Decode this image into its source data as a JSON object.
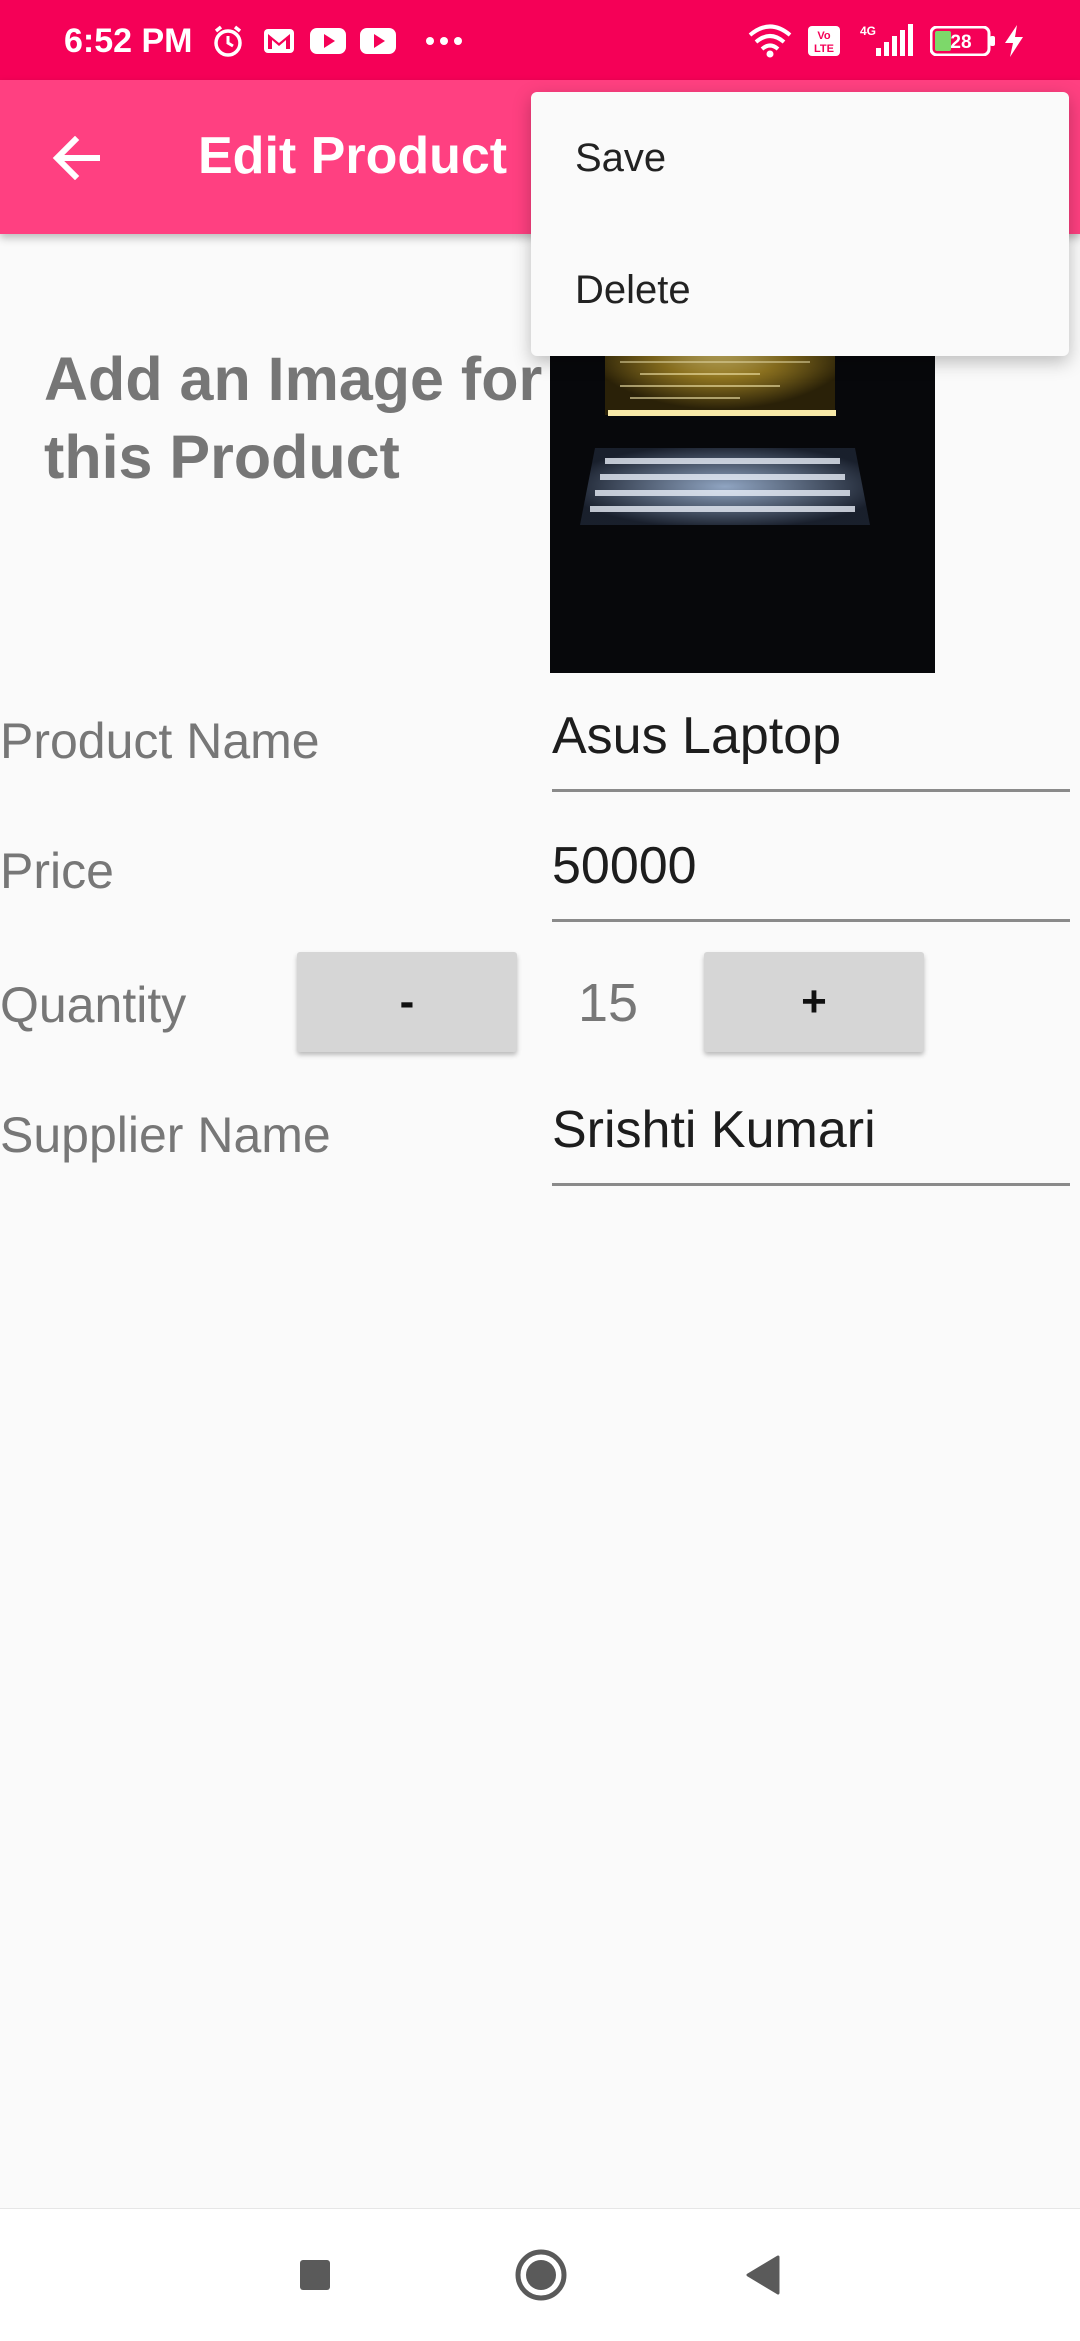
{
  "status_bar": {
    "time": "6:52 PM",
    "battery": "28",
    "icons": [
      "alarm-icon",
      "gmail-icon",
      "youtube-icon",
      "youtube-icon",
      "more-dots-icon",
      "wifi-icon",
      "volte-icon",
      "signal-4g-icon",
      "battery-icon",
      "charging-icon"
    ]
  },
  "app_bar": {
    "title": "Edit Product",
    "back_icon": "arrow-back-icon",
    "background": "#ff4081"
  },
  "overflow_menu": {
    "items": [
      {
        "label": "Save"
      },
      {
        "label": "Delete"
      }
    ]
  },
  "image_section": {
    "prompt": "Add an Image for this Product",
    "image_icon": "laptop-photo"
  },
  "form": {
    "product_name": {
      "label": "Product Name",
      "value": "Asus Laptop"
    },
    "price": {
      "label": "Price",
      "value": "50000"
    },
    "quantity": {
      "label": "Quantity",
      "decrement": "-",
      "value": "15",
      "increment": "+"
    },
    "supplier_name": {
      "label": "Supplier Name",
      "value": "Srishti Kumari"
    }
  },
  "nav_bar": {
    "icons": [
      "recents-square-icon",
      "home-circle-icon",
      "back-triangle-icon"
    ]
  },
  "colors": {
    "status_bar": "#f50057",
    "accent": "#ff4081",
    "label_text": "#777777"
  }
}
